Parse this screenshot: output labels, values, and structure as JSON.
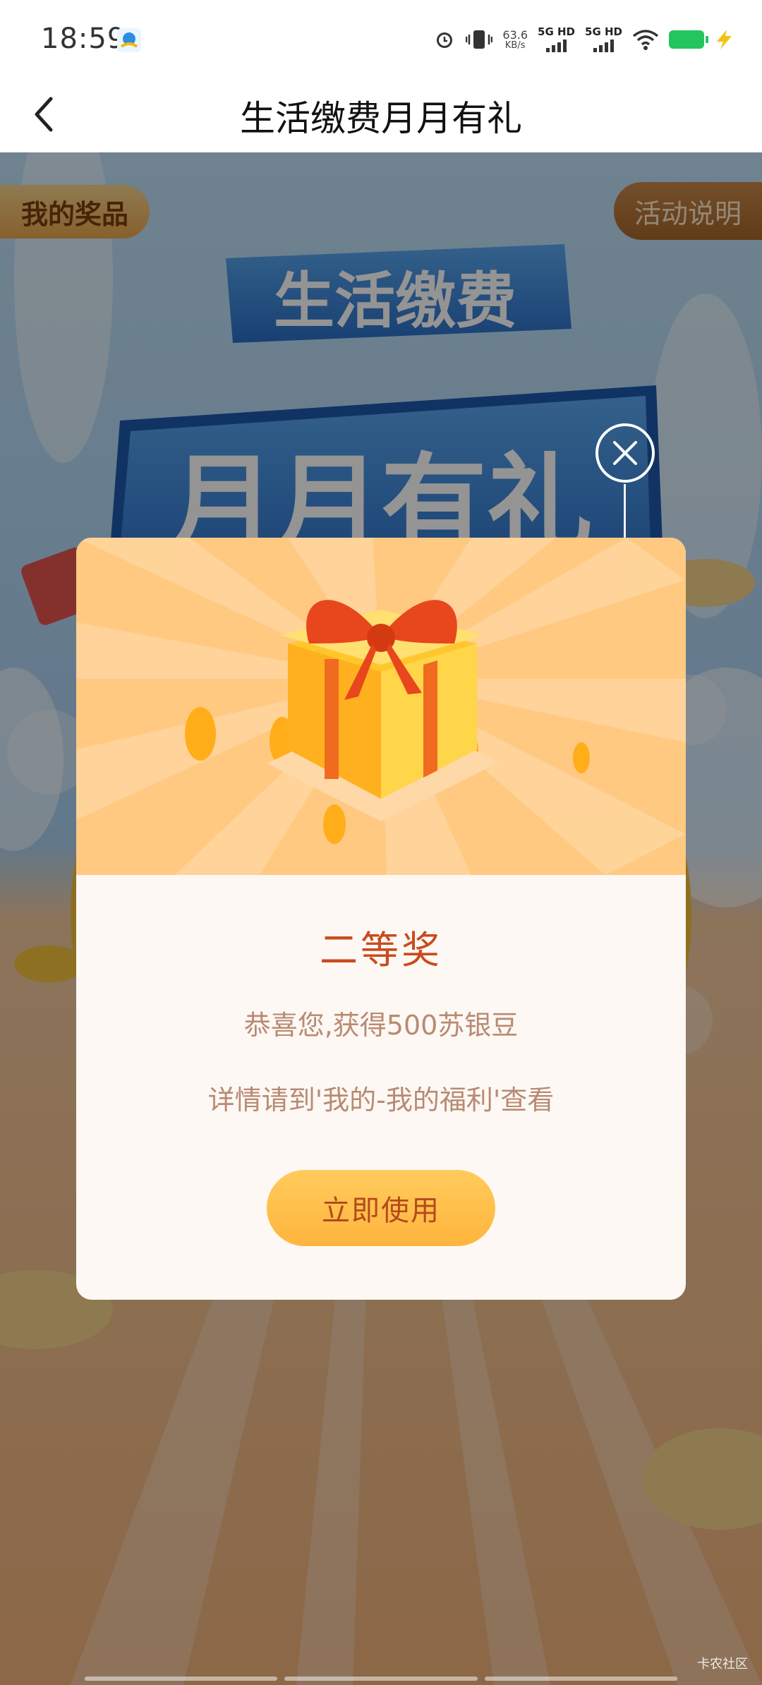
{
  "status_bar": {
    "time": "18:59",
    "net_speed_value": "63.6",
    "net_speed_unit": "KB/s",
    "sim1": "5G HD",
    "sim2": "5G HD",
    "icons": [
      "alarm-icon",
      "vibrate-icon",
      "wifi-icon",
      "battery-icon",
      "charging-icon"
    ]
  },
  "nav": {
    "title": "生活缴费月月有礼",
    "back_icon": "chevron-left-icon"
  },
  "page": {
    "my_prizes": "我的奖品",
    "rules": "活动说明",
    "banner_line1": "生活缴费",
    "banner_line2": "月月有礼"
  },
  "modal": {
    "title": "二等奖",
    "line1": "恭喜您,获得500苏银豆",
    "line2": "详情请到'我的-我的福利'查看",
    "button": "立即使用",
    "close_icon": "close-icon",
    "illustration": "gift-box-icon"
  },
  "watermark": "卡农社区",
  "colors": {
    "modal_bg": "#fdf8f3",
    "modal_top": "#ffc982",
    "title": "#c84b1e",
    "body_text": "#b88a73",
    "button_bg": "#ffbd48",
    "banner_blue": "#2f78d2"
  }
}
